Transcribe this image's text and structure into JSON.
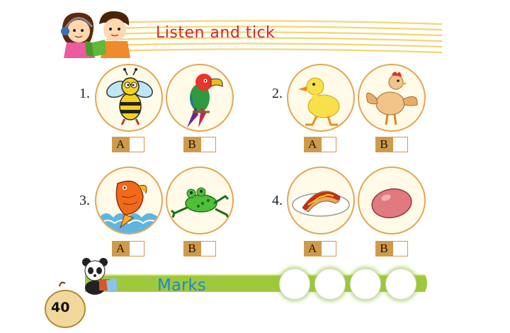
{
  "header": {
    "title": "Listen and tick"
  },
  "questions": [
    {
      "number": "1.",
      "options": [
        {
          "label": "A",
          "picture": "bee-icon"
        },
        {
          "label": "B",
          "picture": "parrot-icon"
        }
      ]
    },
    {
      "number": "2.",
      "options": [
        {
          "label": "A",
          "picture": "duck-icon"
        },
        {
          "label": "B",
          "picture": "hen-icon"
        }
      ]
    },
    {
      "number": "3.",
      "options": [
        {
          "label": "A",
          "picture": "fish-icon"
        },
        {
          "label": "B",
          "picture": "frog-icon"
        }
      ]
    },
    {
      "number": "4.",
      "options": [
        {
          "label": "A",
          "picture": "hotdog-icon"
        },
        {
          "label": "B",
          "picture": "egg-icon"
        }
      ]
    }
  ],
  "marks": {
    "label": "Marks",
    "slots": 4
  },
  "page": {
    "number": "40"
  },
  "colors": {
    "title": "#d2262f",
    "stripes": "#f4d571",
    "circle_border": "#e4a654",
    "option_label_bg": "#cf9b4a",
    "marks_bar": "#9fc93c",
    "marks_text": "#1e88d0"
  }
}
